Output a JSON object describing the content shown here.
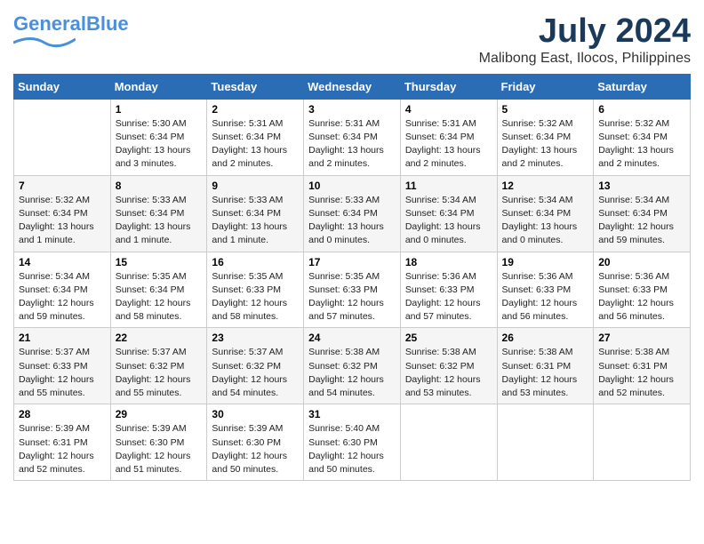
{
  "logo": {
    "line1": "General",
    "line2": "Blue"
  },
  "title": "July 2024",
  "location": "Malibong East, Ilocos, Philippines",
  "weekdays": [
    "Sunday",
    "Monday",
    "Tuesday",
    "Wednesday",
    "Thursday",
    "Friday",
    "Saturday"
  ],
  "weeks": [
    [
      {
        "day": "",
        "info": ""
      },
      {
        "day": "1",
        "info": "Sunrise: 5:30 AM\nSunset: 6:34 PM\nDaylight: 13 hours\nand 3 minutes."
      },
      {
        "day": "2",
        "info": "Sunrise: 5:31 AM\nSunset: 6:34 PM\nDaylight: 13 hours\nand 2 minutes."
      },
      {
        "day": "3",
        "info": "Sunrise: 5:31 AM\nSunset: 6:34 PM\nDaylight: 13 hours\nand 2 minutes."
      },
      {
        "day": "4",
        "info": "Sunrise: 5:31 AM\nSunset: 6:34 PM\nDaylight: 13 hours\nand 2 minutes."
      },
      {
        "day": "5",
        "info": "Sunrise: 5:32 AM\nSunset: 6:34 PM\nDaylight: 13 hours\nand 2 minutes."
      },
      {
        "day": "6",
        "info": "Sunrise: 5:32 AM\nSunset: 6:34 PM\nDaylight: 13 hours\nand 2 minutes."
      }
    ],
    [
      {
        "day": "7",
        "info": "Sunrise: 5:32 AM\nSunset: 6:34 PM\nDaylight: 13 hours\nand 1 minute."
      },
      {
        "day": "8",
        "info": "Sunrise: 5:33 AM\nSunset: 6:34 PM\nDaylight: 13 hours\nand 1 minute."
      },
      {
        "day": "9",
        "info": "Sunrise: 5:33 AM\nSunset: 6:34 PM\nDaylight: 13 hours\nand 1 minute."
      },
      {
        "day": "10",
        "info": "Sunrise: 5:33 AM\nSunset: 6:34 PM\nDaylight: 13 hours\nand 0 minutes."
      },
      {
        "day": "11",
        "info": "Sunrise: 5:34 AM\nSunset: 6:34 PM\nDaylight: 13 hours\nand 0 minutes."
      },
      {
        "day": "12",
        "info": "Sunrise: 5:34 AM\nSunset: 6:34 PM\nDaylight: 13 hours\nand 0 minutes."
      },
      {
        "day": "13",
        "info": "Sunrise: 5:34 AM\nSunset: 6:34 PM\nDaylight: 12 hours\nand 59 minutes."
      }
    ],
    [
      {
        "day": "14",
        "info": "Sunrise: 5:34 AM\nSunset: 6:34 PM\nDaylight: 12 hours\nand 59 minutes."
      },
      {
        "day": "15",
        "info": "Sunrise: 5:35 AM\nSunset: 6:34 PM\nDaylight: 12 hours\nand 58 minutes."
      },
      {
        "day": "16",
        "info": "Sunrise: 5:35 AM\nSunset: 6:33 PM\nDaylight: 12 hours\nand 58 minutes."
      },
      {
        "day": "17",
        "info": "Sunrise: 5:35 AM\nSunset: 6:33 PM\nDaylight: 12 hours\nand 57 minutes."
      },
      {
        "day": "18",
        "info": "Sunrise: 5:36 AM\nSunset: 6:33 PM\nDaylight: 12 hours\nand 57 minutes."
      },
      {
        "day": "19",
        "info": "Sunrise: 5:36 AM\nSunset: 6:33 PM\nDaylight: 12 hours\nand 56 minutes."
      },
      {
        "day": "20",
        "info": "Sunrise: 5:36 AM\nSunset: 6:33 PM\nDaylight: 12 hours\nand 56 minutes."
      }
    ],
    [
      {
        "day": "21",
        "info": "Sunrise: 5:37 AM\nSunset: 6:33 PM\nDaylight: 12 hours\nand 55 minutes."
      },
      {
        "day": "22",
        "info": "Sunrise: 5:37 AM\nSunset: 6:32 PM\nDaylight: 12 hours\nand 55 minutes."
      },
      {
        "day": "23",
        "info": "Sunrise: 5:37 AM\nSunset: 6:32 PM\nDaylight: 12 hours\nand 54 minutes."
      },
      {
        "day": "24",
        "info": "Sunrise: 5:38 AM\nSunset: 6:32 PM\nDaylight: 12 hours\nand 54 minutes."
      },
      {
        "day": "25",
        "info": "Sunrise: 5:38 AM\nSunset: 6:32 PM\nDaylight: 12 hours\nand 53 minutes."
      },
      {
        "day": "26",
        "info": "Sunrise: 5:38 AM\nSunset: 6:31 PM\nDaylight: 12 hours\nand 53 minutes."
      },
      {
        "day": "27",
        "info": "Sunrise: 5:38 AM\nSunset: 6:31 PM\nDaylight: 12 hours\nand 52 minutes."
      }
    ],
    [
      {
        "day": "28",
        "info": "Sunrise: 5:39 AM\nSunset: 6:31 PM\nDaylight: 12 hours\nand 52 minutes."
      },
      {
        "day": "29",
        "info": "Sunrise: 5:39 AM\nSunset: 6:30 PM\nDaylight: 12 hours\nand 51 minutes."
      },
      {
        "day": "30",
        "info": "Sunrise: 5:39 AM\nSunset: 6:30 PM\nDaylight: 12 hours\nand 50 minutes."
      },
      {
        "day": "31",
        "info": "Sunrise: 5:40 AM\nSunset: 6:30 PM\nDaylight: 12 hours\nand 50 minutes."
      },
      {
        "day": "",
        "info": ""
      },
      {
        "day": "",
        "info": ""
      },
      {
        "day": "",
        "info": ""
      }
    ]
  ]
}
